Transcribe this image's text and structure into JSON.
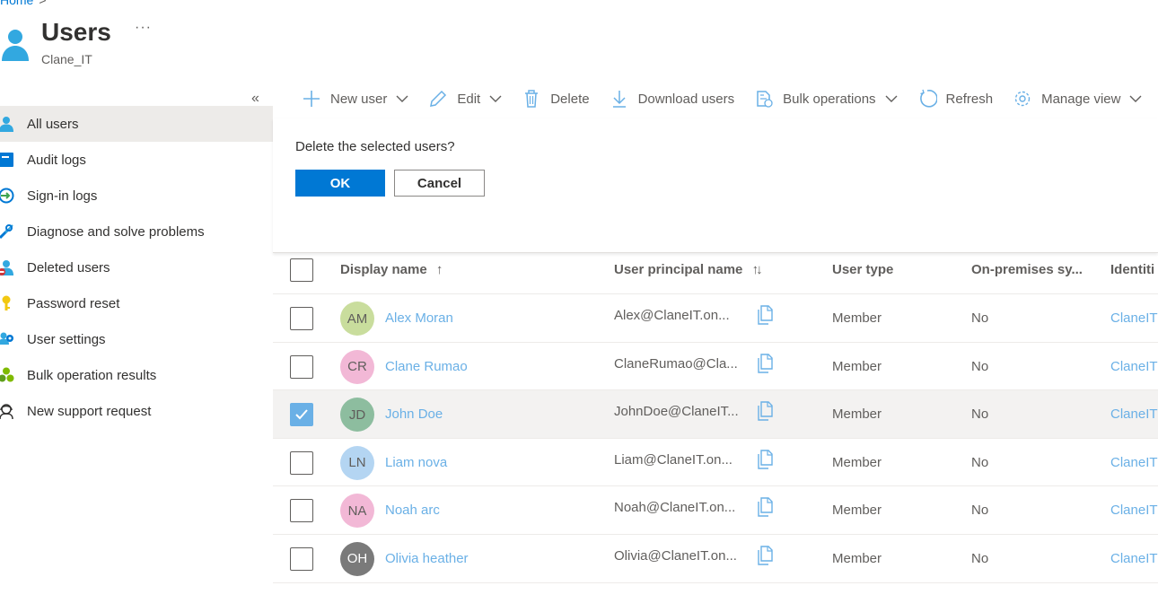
{
  "breadcrumb": {
    "home": "Home",
    "sep": ">"
  },
  "header": {
    "title": "Users",
    "subtitle": "Clane_IT",
    "more": "···",
    "icon": "user-icon"
  },
  "sidebar": {
    "collapse": "«",
    "items": [
      {
        "label": "All users",
        "icon": "user-icon",
        "active": true
      },
      {
        "label": "Audit logs",
        "icon": "audit-log-icon"
      },
      {
        "label": "Sign-in logs",
        "icon": "sign-in-icon"
      },
      {
        "label": "Diagnose and solve problems",
        "icon": "wrench-icon"
      },
      {
        "label": "Deleted users",
        "icon": "deleted-user-icon"
      },
      {
        "label": "Password reset",
        "icon": "key-icon"
      },
      {
        "label": "User settings",
        "icon": "user-settings-icon"
      },
      {
        "label": "Bulk operation results",
        "icon": "bulk-results-icon"
      },
      {
        "label": "New support request",
        "icon": "support-icon"
      }
    ]
  },
  "toolbar": {
    "new_user": "New user",
    "edit": "Edit",
    "delete": "Delete",
    "download": "Download users",
    "bulk": "Bulk operations",
    "refresh": "Refresh",
    "manage": "Manage view"
  },
  "dialog": {
    "text": "Delete the selected users?",
    "ok": "OK",
    "cancel": "Cancel"
  },
  "table": {
    "columns": {
      "display_name": "Display name",
      "sort_asc": "↑",
      "upn": "User principal name",
      "sort_both": "↑↓",
      "user_type": "User type",
      "on_prem": "On-premises sy...",
      "identities": "Identiti"
    },
    "rows": [
      {
        "initials": "AM",
        "name": "Alex Moran",
        "upn": "Alex@ClaneIT.on...",
        "type": "Member",
        "onprem": "No",
        "identity": "ClaneIT",
        "avatar_color": "#c9dd9d",
        "checked": false
      },
      {
        "initials": "CR",
        "name": "Clane Rumao",
        "upn": "ClaneRumao@Cla...",
        "type": "Member",
        "onprem": "No",
        "identity": "ClaneIT",
        "avatar_color": "#f2b8d6",
        "checked": false
      },
      {
        "initials": "JD",
        "name": "John Doe",
        "upn": "JohnDoe@ClaneIT...",
        "type": "Member",
        "onprem": "No",
        "identity": "ClaneIT",
        "avatar_color": "#8dbd9f",
        "checked": true
      },
      {
        "initials": "LN",
        "name": "Liam nova",
        "upn": "Liam@ClaneIT.on...",
        "type": "Member",
        "onprem": "No",
        "identity": "ClaneIT",
        "avatar_color": "#b4d5f2",
        "checked": false
      },
      {
        "initials": "NA",
        "name": "Noah arc",
        "upn": "Noah@ClaneIT.on...",
        "type": "Member",
        "onprem": "No",
        "identity": "ClaneIT",
        "avatar_color": "#f2b8d6",
        "checked": false
      },
      {
        "initials": "OH",
        "name": "Olivia heather",
        "upn": "Olivia@ClaneIT.on...",
        "type": "Member",
        "onprem": "No",
        "identity": "ClaneIT",
        "avatar_color": "#7a7a7a",
        "checked": false
      }
    ]
  },
  "colors": {
    "accent": "#0078d4",
    "link": "#6ab0e6",
    "nav_active": "#edebe9"
  }
}
